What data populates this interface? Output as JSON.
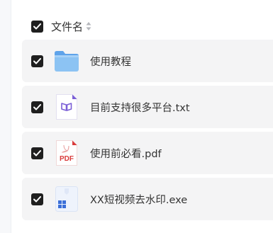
{
  "header": {
    "label": "文件名"
  },
  "files": [
    {
      "name": "使用教程",
      "icon": "folder-icon",
      "checked": true
    },
    {
      "name": "目前支持很多平台.txt",
      "icon": "text-file-icon",
      "checked": true
    },
    {
      "name": "使用前必看.pdf",
      "icon": "pdf-file-icon",
      "checked": true,
      "icon_text": "PDF"
    },
    {
      "name": "XX短视频去水印.exe",
      "icon": "exe-file-icon",
      "checked": true
    }
  ],
  "colors": {
    "checkbox": "#1f1f1f",
    "row_background": "#f4f4f5",
    "folder": "#7fb9f0",
    "pdf_red": "#d93a3a",
    "txt_purple": "#7b5fd6",
    "exe_blue": "#3b6fd8"
  }
}
